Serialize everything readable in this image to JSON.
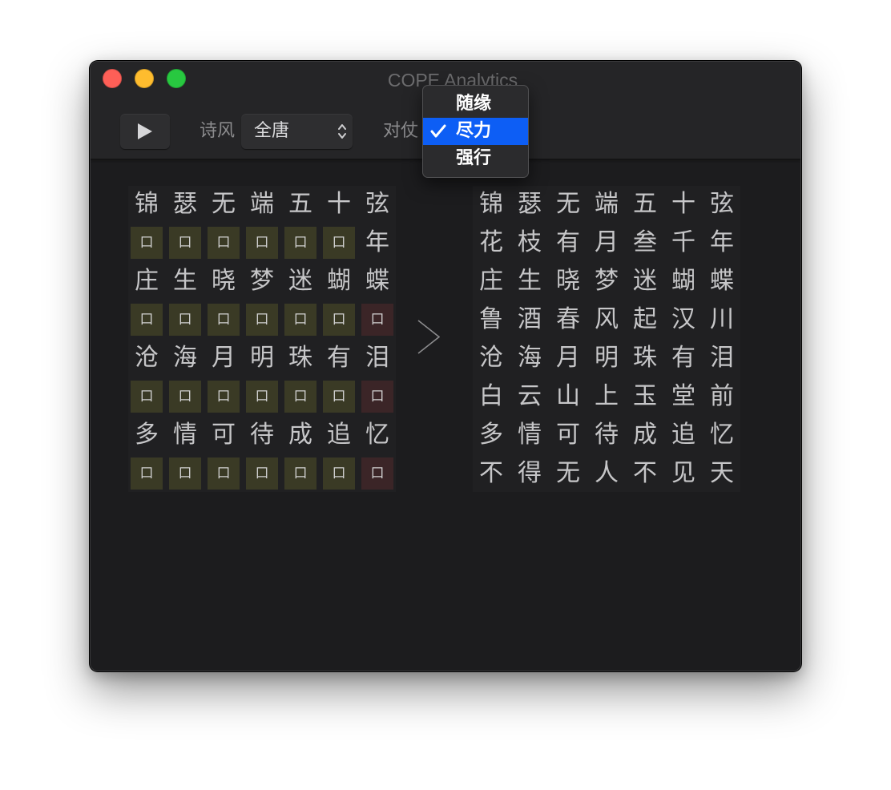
{
  "window": {
    "title": "COPE Analytics"
  },
  "icons": {
    "close": "close-window-icon",
    "minimize": "minimize-window-icon",
    "zoom": "zoom-window-icon",
    "play": "play-icon",
    "popup_arrows": "updown-chevron-icon",
    "check": "checkmark-icon",
    "transform_arrow": "chevron-right-icon"
  },
  "colors": {
    "close": "#fe5f57",
    "minimize": "#febc2e",
    "zoom": "#28c840",
    "menu_selection": "#0d5ef5",
    "blank": "#3a3a25",
    "blank_highlight": "#3b2527"
  },
  "toolbar": {
    "style_label": "诗风",
    "style_value": "全唐",
    "parallel_label": "对仗"
  },
  "parallel_menu": {
    "selected_index": 1,
    "items": [
      {
        "label": "随缘"
      },
      {
        "label": "尽力"
      },
      {
        "label": "强行"
      }
    ]
  },
  "input_poem": {
    "rows": [
      {
        "cells": [
          {
            "c": "锦",
            "s": "text"
          },
          {
            "c": "瑟",
            "s": "text"
          },
          {
            "c": "无",
            "s": "text"
          },
          {
            "c": "端",
            "s": "text"
          },
          {
            "c": "五",
            "s": "text"
          },
          {
            "c": "十",
            "s": "text"
          },
          {
            "c": "弦",
            "s": "text"
          }
        ]
      },
      {
        "cells": [
          {
            "c": "口",
            "s": "blank"
          },
          {
            "c": "口",
            "s": "blank"
          },
          {
            "c": "口",
            "s": "blank"
          },
          {
            "c": "口",
            "s": "blank"
          },
          {
            "c": "口",
            "s": "blank"
          },
          {
            "c": "口",
            "s": "blank"
          },
          {
            "c": "年",
            "s": "text"
          }
        ]
      },
      {
        "cells": [
          {
            "c": "庄",
            "s": "text"
          },
          {
            "c": "生",
            "s": "text"
          },
          {
            "c": "晓",
            "s": "text"
          },
          {
            "c": "梦",
            "s": "text"
          },
          {
            "c": "迷",
            "s": "text"
          },
          {
            "c": "蝴",
            "s": "text"
          },
          {
            "c": "蝶",
            "s": "text"
          }
        ]
      },
      {
        "cells": [
          {
            "c": "口",
            "s": "blank"
          },
          {
            "c": "口",
            "s": "blank"
          },
          {
            "c": "口",
            "s": "blank"
          },
          {
            "c": "口",
            "s": "blank"
          },
          {
            "c": "口",
            "s": "blank"
          },
          {
            "c": "口",
            "s": "blank"
          },
          {
            "c": "口",
            "s": "blank_highlight"
          }
        ]
      },
      {
        "cells": [
          {
            "c": "沧",
            "s": "text"
          },
          {
            "c": "海",
            "s": "text"
          },
          {
            "c": "月",
            "s": "text"
          },
          {
            "c": "明",
            "s": "text"
          },
          {
            "c": "珠",
            "s": "text"
          },
          {
            "c": "有",
            "s": "text"
          },
          {
            "c": "泪",
            "s": "text"
          }
        ]
      },
      {
        "cells": [
          {
            "c": "口",
            "s": "blank"
          },
          {
            "c": "口",
            "s": "blank"
          },
          {
            "c": "口",
            "s": "blank"
          },
          {
            "c": "口",
            "s": "blank"
          },
          {
            "c": "口",
            "s": "blank"
          },
          {
            "c": "口",
            "s": "blank"
          },
          {
            "c": "口",
            "s": "blank_highlight"
          }
        ]
      },
      {
        "cells": [
          {
            "c": "多",
            "s": "text"
          },
          {
            "c": "情",
            "s": "text"
          },
          {
            "c": "可",
            "s": "text"
          },
          {
            "c": "待",
            "s": "text"
          },
          {
            "c": "成",
            "s": "text"
          },
          {
            "c": "追",
            "s": "text"
          },
          {
            "c": "忆",
            "s": "text"
          }
        ]
      },
      {
        "cells": [
          {
            "c": "口",
            "s": "blank"
          },
          {
            "c": "口",
            "s": "blank"
          },
          {
            "c": "口",
            "s": "blank"
          },
          {
            "c": "口",
            "s": "blank"
          },
          {
            "c": "口",
            "s": "blank"
          },
          {
            "c": "口",
            "s": "blank"
          },
          {
            "c": "口",
            "s": "blank_highlight"
          }
        ]
      }
    ]
  },
  "output_poem": {
    "rows": [
      [
        "锦",
        "瑟",
        "无",
        "端",
        "五",
        "十",
        "弦"
      ],
      [
        "花",
        "枝",
        "有",
        "月",
        "叁",
        "千",
        "年"
      ],
      [
        "庄",
        "生",
        "晓",
        "梦",
        "迷",
        "蝴",
        "蝶"
      ],
      [
        "鲁",
        "酒",
        "春",
        "风",
        "起",
        "汉",
        "川"
      ],
      [
        "沧",
        "海",
        "月",
        "明",
        "珠",
        "有",
        "泪"
      ],
      [
        "白",
        "云",
        "山",
        "上",
        "玉",
        "堂",
        "前"
      ],
      [
        "多",
        "情",
        "可",
        "待",
        "成",
        "追",
        "忆"
      ],
      [
        "不",
        "得",
        "无",
        "人",
        "不",
        "见",
        "天"
      ]
    ]
  }
}
